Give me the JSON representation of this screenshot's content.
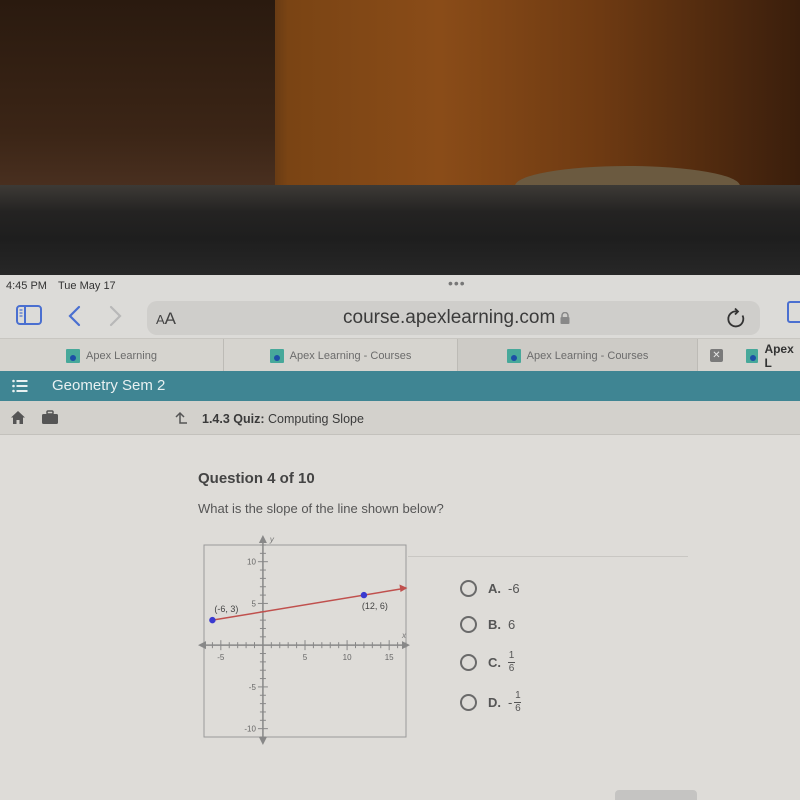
{
  "status_bar": {
    "time": "4:45 PM",
    "date": "Tue May 17",
    "more_dots": "•••"
  },
  "browser": {
    "text_size_label_small": "A",
    "text_size_label_large": "A",
    "url": "course.apexlearning.com",
    "lock_icon": "lock-icon",
    "reload_icon": "reload-icon",
    "back_icon": "chevron-left-icon",
    "forward_icon": "chevron-right-icon",
    "tabs": [
      {
        "label": "Apex Learning",
        "active": false
      },
      {
        "label": "Apex Learning - Courses",
        "active": false
      },
      {
        "label": "Apex Learning - Courses",
        "active": true
      },
      {
        "label": "Apex L",
        "active": false
      }
    ],
    "tab_close_glyph": "✕"
  },
  "course": {
    "title": "Geometry Sem 2"
  },
  "breadcrumb": {
    "section": "1.4.3",
    "type": "Quiz:",
    "name": "Computing Slope"
  },
  "question": {
    "header": "Question 4 of 10",
    "prompt": "What is the slope of the line shown below?",
    "answers": [
      {
        "letter": "A.",
        "value": "-6",
        "type": "number"
      },
      {
        "letter": "B.",
        "value": "6",
        "type": "number"
      },
      {
        "letter": "C.",
        "numerator": "1",
        "denominator": "6",
        "sign": "",
        "type": "fraction"
      },
      {
        "letter": "D.",
        "numerator": "1",
        "denominator": "6",
        "sign": "-",
        "type": "fraction"
      }
    ]
  },
  "chart_data": {
    "type": "line",
    "title": "",
    "xlabel": "x",
    "ylabel": "y",
    "xlim": [
      -7,
      17
    ],
    "ylim": [
      -11,
      12
    ],
    "x_ticks": [
      -5,
      5,
      10,
      15
    ],
    "y_ticks": [
      10,
      5,
      -5,
      -10
    ],
    "grid": false,
    "points": [
      {
        "x": -6,
        "y": 3,
        "label": "(-6, 3)"
      },
      {
        "x": 12,
        "y": 6,
        "label": "(12, 6)"
      }
    ],
    "line": {
      "from": [
        -6,
        3
      ],
      "slope": 0.1667,
      "extends_right_with_arrow": true
    },
    "colors": {
      "line": "#c0504d",
      "points": "#3a3ad0",
      "axes": "#888888"
    }
  }
}
